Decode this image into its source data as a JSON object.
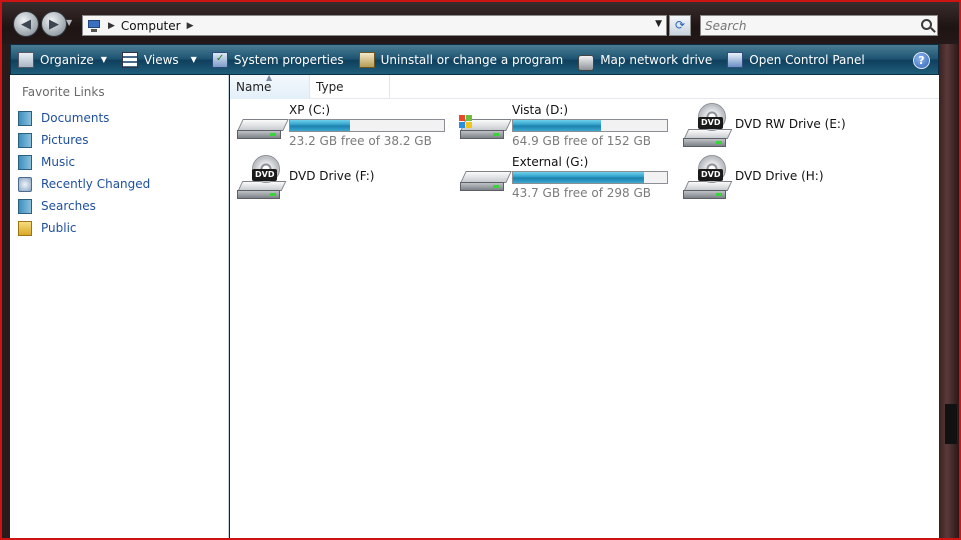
{
  "address_bar": {
    "location": "Computer",
    "search_placeholder": "Search"
  },
  "command_bar": {
    "organize": "Organize",
    "views": "Views",
    "system_properties": "System properties",
    "uninstall": "Uninstall or change a program",
    "map_drive": "Map network drive",
    "control_panel": "Open Control Panel",
    "help_icon": "?"
  },
  "nav_pane": {
    "title": "Favorite Links",
    "items": [
      {
        "label": "Documents",
        "icon": "documents-icon"
      },
      {
        "label": "Pictures",
        "icon": "pictures-icon"
      },
      {
        "label": "Music",
        "icon": "music-icon"
      },
      {
        "label": "Recently Changed",
        "icon": "recently-changed-icon"
      },
      {
        "label": "Searches",
        "icon": "searches-icon"
      },
      {
        "label": "Public",
        "icon": "public-folder-icon"
      }
    ]
  },
  "columns": {
    "name": "Name",
    "type": "Type"
  },
  "drives": [
    {
      "label": "XP (C:)",
      "free_text": "23.2 GB free of 38.2 GB",
      "used_fraction": 0.39,
      "icon": "hard-drive-icon"
    },
    {
      "label": "Vista (D:)",
      "free_text": "64.9 GB free of 152 GB",
      "used_fraction": 0.57,
      "icon": "windows-drive-icon"
    },
    {
      "label": "DVD RW Drive (E:)",
      "icon": "dvd-drive-icon"
    },
    {
      "label": "DVD Drive (F:)",
      "icon": "dvd-drive-icon"
    },
    {
      "label": "External (G:)",
      "free_text": "43.7 GB free of 298 GB",
      "used_fraction": 0.85,
      "icon": "hard-drive-icon"
    },
    {
      "label": "DVD Drive (H:)",
      "icon": "dvd-drive-icon"
    }
  ]
}
